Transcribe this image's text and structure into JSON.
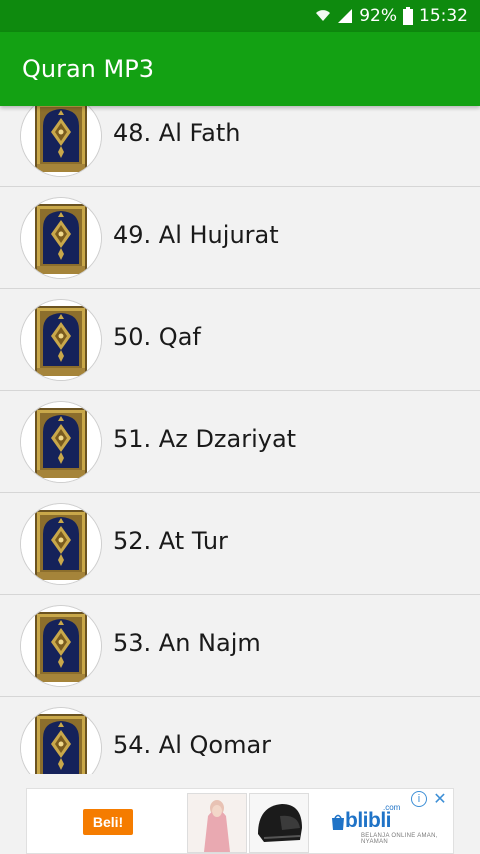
{
  "status_bar": {
    "battery": "92%",
    "time": "15:32",
    "icons": [
      "wifi-icon",
      "signal-icon",
      "battery-icon"
    ]
  },
  "app_bar": {
    "title": "Quran MP3",
    "color": "#13a113"
  },
  "surahs": [
    {
      "label": "48. Al Fath"
    },
    {
      "label": "49. Al Hujurat"
    },
    {
      "label": "50. Qaf"
    },
    {
      "label": "51. Az Dzariyat"
    },
    {
      "label": "52. At Tur"
    },
    {
      "label": "53. An Najm"
    },
    {
      "label": "54. Al Qomar"
    }
  ],
  "item_icon": "quran-cover-icon",
  "ad": {
    "button_label": "Beli!",
    "brand": "blibli",
    "brand_suffix": ".com",
    "tagline": "BELANJA ONLINE AMAN, NYAMAN",
    "info_icon": "info-icon",
    "close_icon": "close-icon",
    "thumbnails": [
      "hijab-product-image",
      "helmet-product-image"
    ]
  }
}
